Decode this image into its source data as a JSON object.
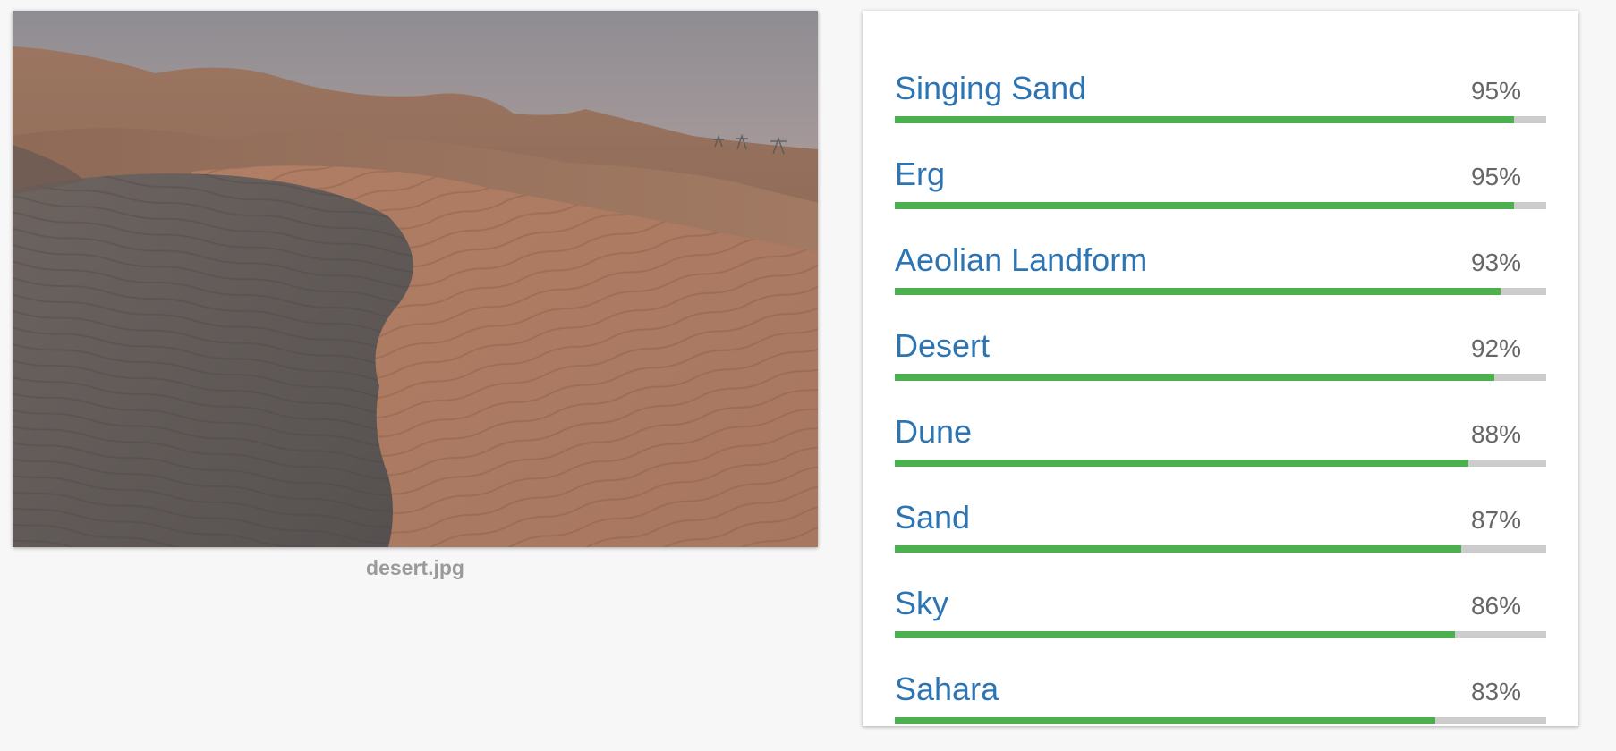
{
  "image": {
    "filename": "desert.jpg"
  },
  "colors": {
    "label_text": "#2d74b3",
    "bar_fill": "#4caf50",
    "bar_track": "#cccccc",
    "score_text": "#666666"
  },
  "labels": [
    {
      "name": "Singing Sand",
      "score": "95%",
      "confidence": 0.95
    },
    {
      "name": "Erg",
      "score": "95%",
      "confidence": 0.95
    },
    {
      "name": "Aeolian Landform",
      "score": "93%",
      "confidence": 0.93
    },
    {
      "name": "Desert",
      "score": "92%",
      "confidence": 0.92
    },
    {
      "name": "Dune",
      "score": "88%",
      "confidence": 0.88
    },
    {
      "name": "Sand",
      "score": "87%",
      "confidence": 0.87
    },
    {
      "name": "Sky",
      "score": "86%",
      "confidence": 0.86
    },
    {
      "name": "Sahara",
      "score": "83%",
      "confidence": 0.83
    }
  ]
}
